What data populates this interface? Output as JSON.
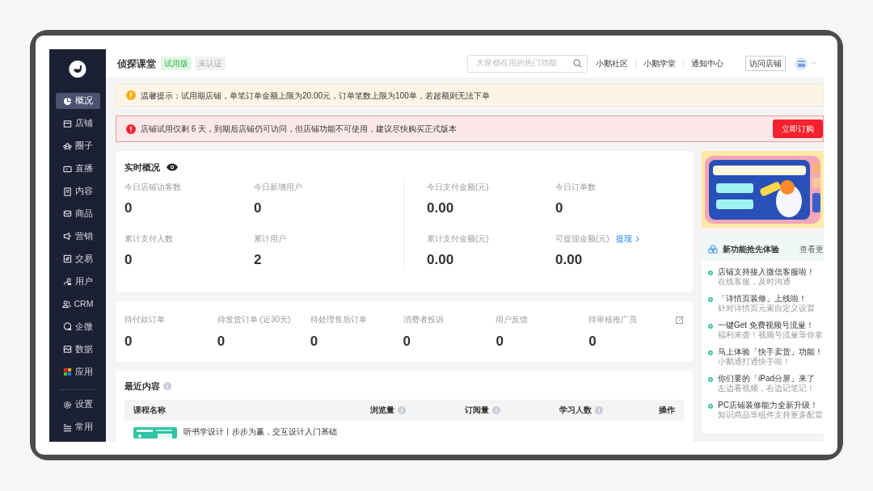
{
  "brand": {
    "name": "侦探课堂",
    "badges": [
      {
        "text": "试用版",
        "kind": "trial"
      },
      {
        "text": "未认证",
        "kind": "unverified"
      }
    ]
  },
  "search": {
    "placeholder": "大家都在用的热门功能"
  },
  "top_links": [
    "小鹅社区",
    "小鹅学堂",
    "通知中心"
  ],
  "visit_button": "访问店铺",
  "sidebar": {
    "items": [
      {
        "label": "概况",
        "selected": true
      },
      {
        "label": "店铺",
        "selected": false
      },
      {
        "label": "圈子",
        "selected": false
      },
      {
        "label": "直播",
        "selected": false
      },
      {
        "label": "内容",
        "selected": false
      },
      {
        "label": "商品",
        "selected": false
      },
      {
        "label": "营销",
        "selected": false
      },
      {
        "label": "交易",
        "selected": false
      },
      {
        "label": "用户",
        "selected": false
      },
      {
        "label": "CRM",
        "selected": false
      },
      {
        "label": "企微",
        "selected": false
      },
      {
        "label": "数据",
        "selected": false
      },
      {
        "label": "应用",
        "selected": false
      }
    ],
    "bottom_items": [
      {
        "label": "设置",
        "selected": false
      },
      {
        "label": "常用",
        "selected": false
      }
    ]
  },
  "notices": [
    {
      "kind": "warning",
      "text": "温馨提示：试用期店铺，单笔订单金额上限为20.00元，订单笔数上限为100单，若超额则无法下单"
    },
    {
      "kind": "error",
      "text": "店铺试用仅剩 6 天，到期后店铺仍可访问，但店铺功能不可使用，建议尽快购买正式版本",
      "button": "立即订购"
    }
  ],
  "realtime": {
    "title": "实时概况",
    "groups": [
      [
        {
          "label": "今日店铺访客数",
          "value": "0"
        },
        {
          "label": "今日新增用户",
          "value": "0"
        },
        {
          "label": "累计支付人数",
          "value": "0"
        },
        {
          "label": "累计用户",
          "value": "2"
        }
      ],
      [
        {
          "label": "今日支付金额(元)",
          "value": "0.00"
        },
        {
          "label": "今日订单数",
          "value": "0"
        },
        {
          "label": "累计支付金额(元)",
          "value": "0.00"
        },
        {
          "label": "可提现金额(元)",
          "value": "0.00",
          "link": "提现"
        }
      ]
    ]
  },
  "pending": [
    {
      "label": "待付款订单",
      "value": "0"
    },
    {
      "label": "待发货订单 (近30天)",
      "value": "0"
    },
    {
      "label": "待处理售后订单",
      "value": "0"
    },
    {
      "label": "消费者投诉",
      "value": "0"
    },
    {
      "label": "用户反馈",
      "value": "0"
    },
    {
      "label": "待审核推广员",
      "value": "0"
    }
  ],
  "recent": {
    "title": "最近内容",
    "columns": [
      {
        "label": "课程名称",
        "info": false
      },
      {
        "label": "浏览量",
        "info": true
      },
      {
        "label": "订阅量",
        "info": true
      },
      {
        "label": "学习人数",
        "info": true
      },
      {
        "label": "操作",
        "info": false
      }
    ],
    "rows": [
      {
        "title": "听书学设计丨步步为赢，交互设计入门基础"
      }
    ]
  },
  "promo": {
    "kind": "picture"
  },
  "features": {
    "title": "新功能抢先体验",
    "more": "查看更",
    "items": [
      {
        "title": "店铺支持接入微信客服啦！",
        "subtitle": "在线客服，及时沟通"
      },
      {
        "title": "「详情页装修」上线啦！",
        "subtitle": "针对详情页元素自定义设置"
      },
      {
        "title": "一键Get 免费视频号流量！",
        "subtitle": "福利来袭！视频号流量等你拿"
      },
      {
        "title": "马上体验「快手卖货」功能！",
        "subtitle": "小鹅通打通快手啦！"
      },
      {
        "title": "你们要的「iPad分屏」来了",
        "subtitle": "左边看视频，右边记笔记！"
      },
      {
        "title": "PC店铺装修能力全新升级！",
        "subtitle": "知识商品等组件支持更多配置"
      }
    ]
  }
}
